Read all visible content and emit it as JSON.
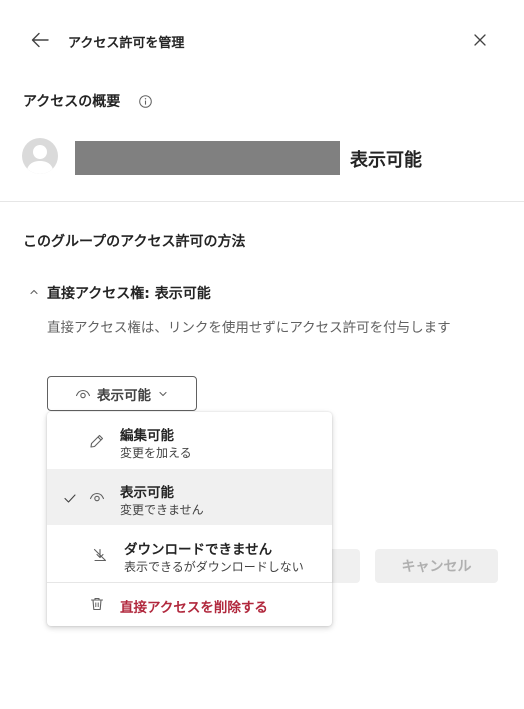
{
  "header": {
    "title": "アクセス許可を管理"
  },
  "overview": {
    "title": "アクセスの概要",
    "permission": "表示可能"
  },
  "group_access": {
    "title": "このグループのアクセス許可の方法",
    "direct": {
      "title": "直接アクセス権: 表示可能",
      "description": "直接アクセス権は、リンクを使用せずにアクセス許可を付与します"
    },
    "select_label": "表示可能"
  },
  "dropdown": {
    "items": [
      {
        "title": "編集可能",
        "subtitle": "変更を加える",
        "icon": "pencil-icon",
        "selected": false
      },
      {
        "title": "表示可能",
        "subtitle": "変更できません",
        "icon": "eye-icon",
        "selected": true
      },
      {
        "title": "ダウンロードできません",
        "subtitle": "表示できるがダウンロードしない",
        "icon": "no-download-icon",
        "selected": false
      }
    ],
    "delete_label": "直接アクセスを削除する"
  },
  "buttons": {
    "cancel": "キャンセル"
  },
  "colors": {
    "danger": "#b1283d",
    "redacted": "#808080",
    "selected_bg": "#f0f0f0"
  }
}
